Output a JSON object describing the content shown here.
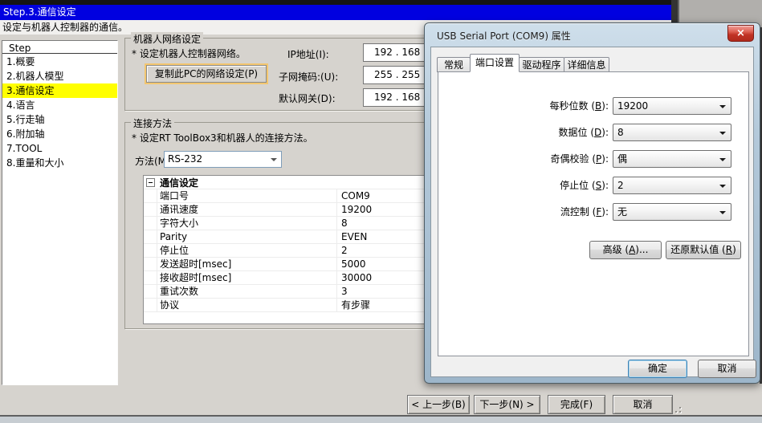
{
  "colors": {
    "accent_blue": "#0000e0",
    "highlight_yellow": "#ffff00",
    "dialog_frame_blue": "#a9c0d4",
    "close_button_red": "#c03224"
  },
  "wizard": {
    "header": {
      "step_title": "Step.3.通信设定",
      "subtitle": "设定与机器人控制器的通信。"
    },
    "sidebar": {
      "title": "Step",
      "items": [
        {
          "label": "1.概要",
          "active": false
        },
        {
          "label": "2.机器人模型",
          "active": false
        },
        {
          "label": "3.通信设定",
          "active": true
        },
        {
          "label": "4.语言",
          "active": false
        },
        {
          "label": "5.行走轴",
          "active": false
        },
        {
          "label": "6.附加轴",
          "active": false
        },
        {
          "label": "7.TOOL",
          "active": false
        },
        {
          "label": "8.重量和大小",
          "active": false
        }
      ]
    },
    "network_group": {
      "title": "机器人网络设定",
      "note": "* 设定机器人控制器网络。",
      "copy_button_label": "复制此PC的网络设定(P)",
      "fields": [
        {
          "label": "IP地址(I):",
          "value": "192 . 168"
        },
        {
          "label": "子网掩码:(U):",
          "value": "255 . 255"
        },
        {
          "label": "默认网关(D):",
          "value": "192 . 168"
        }
      ]
    },
    "connection_group": {
      "title": "连接方法",
      "note": "* 设定RT ToolBox3和机器人的连接方法。",
      "method_label": "方法(M):",
      "method_value": "RS-232",
      "grid": {
        "header": "通信设定",
        "rows": [
          {
            "name": "端口号",
            "value": "COM9"
          },
          {
            "name": "通讯速度",
            "value": "19200"
          },
          {
            "name": "字符大小",
            "value": "8"
          },
          {
            "name": "Parity",
            "value": "EVEN"
          },
          {
            "name": "停止位",
            "value": "2"
          },
          {
            "name": "发送超时[msec]",
            "value": "5000"
          },
          {
            "name": "接收超时[msec]",
            "value": "30000"
          },
          {
            "name": "重试次数",
            "value": "3"
          },
          {
            "name": "协议",
            "value": "有步骤"
          }
        ]
      }
    },
    "footer_buttons": [
      {
        "label": "< 上一步(B)"
      },
      {
        "label": "下一步(N) >"
      },
      {
        "label": "完成(F)"
      },
      {
        "label": "取消"
      }
    ]
  },
  "dialog": {
    "title": "USB Serial Port (COM9) 属性",
    "close_glyph": "×",
    "tabs": [
      {
        "label": "常规",
        "active": false
      },
      {
        "label": "端口设置",
        "active": true
      },
      {
        "label": "驱动程序",
        "active": false
      },
      {
        "label": "详细信息",
        "active": false
      }
    ],
    "fields": [
      {
        "label": "每秒位数",
        "accel": "B",
        "value": "19200"
      },
      {
        "label": "数据位",
        "accel": "D",
        "value": "8"
      },
      {
        "label": "奇偶校验",
        "accel": "P",
        "value": "偶"
      },
      {
        "label": "停止位",
        "accel": "S",
        "value": "2"
      },
      {
        "label": "流控制",
        "accel": "F",
        "value": "无"
      }
    ],
    "advanced_button": {
      "label": "高级",
      "accel": "A",
      "suffix": "..."
    },
    "restore_button": {
      "label": "还原默认值",
      "accel": "R",
      "suffix": ""
    },
    "ok_button": "确定",
    "cancel_button": "取消"
  }
}
